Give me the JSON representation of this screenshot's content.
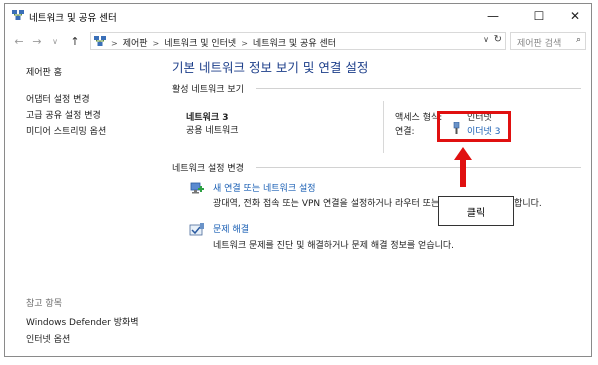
{
  "window": {
    "title": "네트워크 및 공유 센터",
    "controls": {
      "minimize": "—",
      "maximize": "☐",
      "close": "✕"
    }
  },
  "nav": {
    "back": "←",
    "forward": "→",
    "recent": "∨",
    "up": "↑",
    "breadcrumb": [
      "제어판",
      "네트워크 및 인터넷",
      "네트워크 및 공유 센터"
    ],
    "address_dropdown": "∨",
    "refresh": "↻",
    "search_placeholder": "제어판 검색",
    "search_icon": "⌕"
  },
  "sidebar": {
    "home": "제어판 홈",
    "items": [
      "어댑터 설정 변경",
      "고급 공유 설정 변경",
      "미디어 스트리밍 옵션"
    ],
    "see_also_title": "참고 항목",
    "see_also": [
      "Windows Defender 방화벽",
      "인터넷 옵션"
    ]
  },
  "main": {
    "heading": "기본 네트워크 정보 보기 및 연결 설정",
    "active_title": "활성 네트워크 보기",
    "network": {
      "name": "네트워크 3",
      "type": "공용 네트워크",
      "access_label": "액세스 형식:",
      "access_value": "인터넷",
      "connection_label": "연결:",
      "connection_value": "이더넷 3"
    },
    "change_title": "네트워크 설정 변경",
    "tasks": [
      {
        "icon": "new-connection-icon",
        "link": "새 연결 또는 네트워크 설정",
        "desc": "광대역, 전화 접속 또는 VPN 연결을 설정하거나 라우터 또는 액세스 지점을 설정합니다."
      },
      {
        "icon": "troubleshoot-icon",
        "link": "문제 해결",
        "desc": "네트워크 문제를 진단 및 해결하거나 문제 해결 정보를 얻습니다."
      }
    ]
  },
  "annotation": {
    "callout_text": "클릭",
    "color": "#e01010"
  }
}
